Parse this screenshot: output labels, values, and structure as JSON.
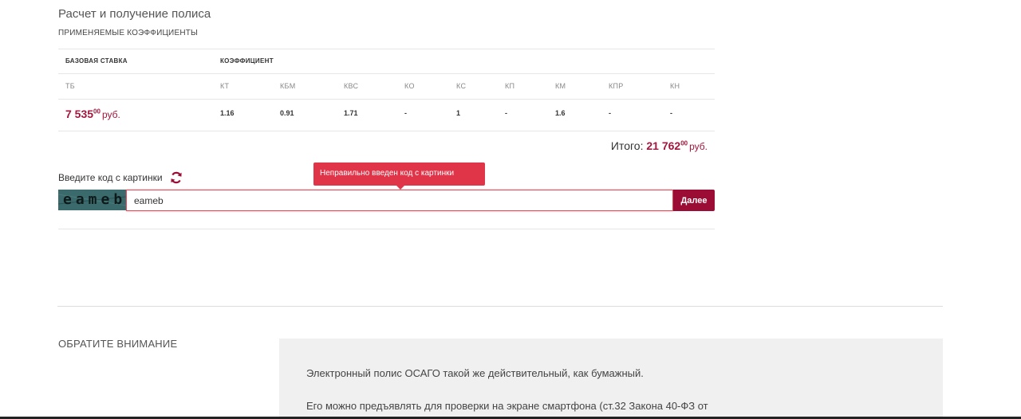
{
  "header": {
    "title": "Расчет и получение полиса",
    "subtitle": "ПРИМЕНЯЕМЫЕ КОЭФФИЦИЕНТЫ"
  },
  "table": {
    "base_rate_header": "БАЗОВАЯ СТАВКА",
    "coef_header": "КОЭФФИЦИЕНТ",
    "columns": [
      "ТБ",
      "КТ",
      "КБМ",
      "КВС",
      "КО",
      "КС",
      "КП",
      "КМ",
      "КПР",
      "КН"
    ],
    "base_rate": {
      "amount": "7 535",
      "kopecks": "00",
      "currency": "руб."
    },
    "values": [
      "1.16",
      "0.91",
      "1.71",
      "-",
      "1",
      "-",
      "1.6",
      "-",
      "-"
    ]
  },
  "total": {
    "label": "Итого:",
    "amount": "21 762",
    "kopecks": "00",
    "currency": "руб."
  },
  "captcha": {
    "label": "Введите код с картинки",
    "image_text": "eameb",
    "input_value": "eameb",
    "error_message": "Неправильно введен код с картинки",
    "submit_label": "Далее"
  },
  "notice": {
    "heading": "ОБРАТИТЕ ВНИМАНИЕ",
    "line1": "Электронный полис ОСАГО такой же действительный, как бумажный.",
    "line2": "Его можно предъявлять для проверки на экране смартфона (ст.32 Закона 40-ФЗ от"
  },
  "colors": {
    "accent": "#9b0d35",
    "price": "#a3173e",
    "error": "#e03448"
  }
}
